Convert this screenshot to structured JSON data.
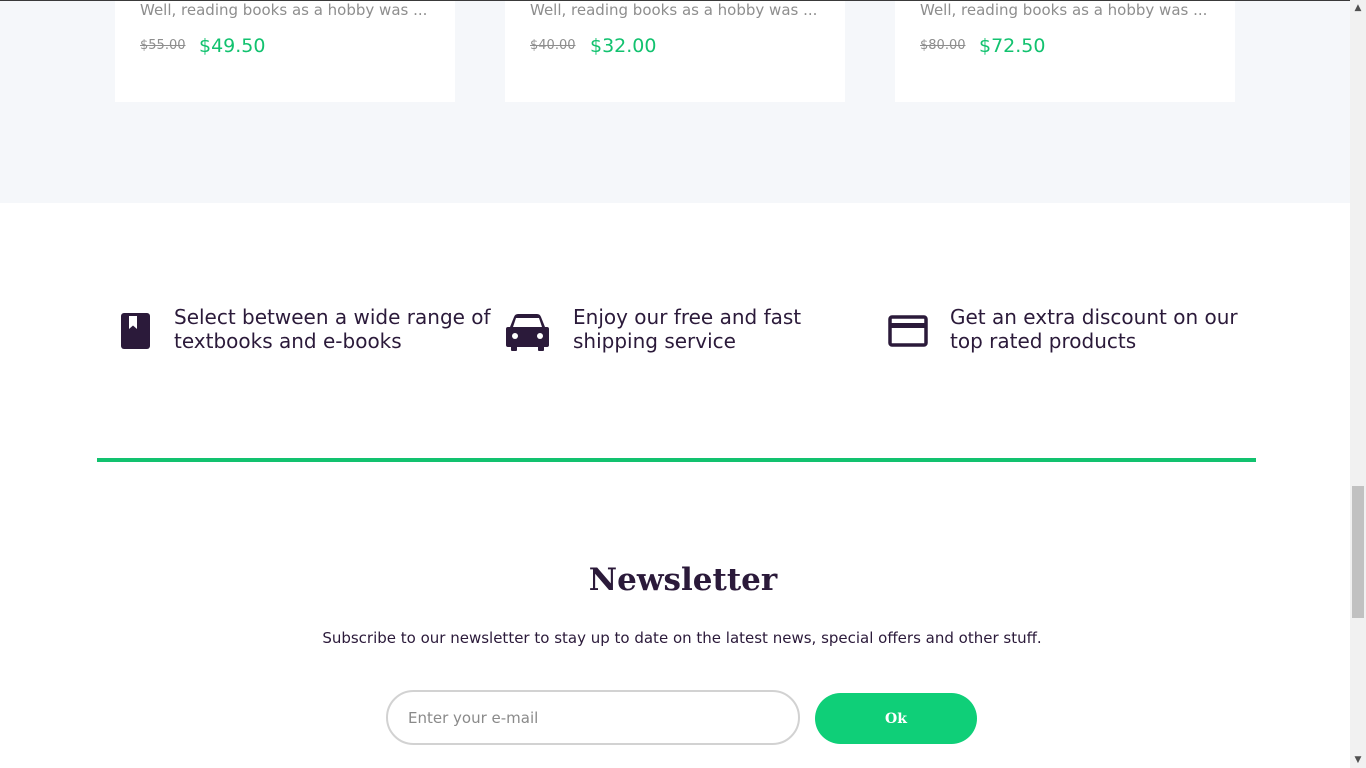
{
  "products": [
    {
      "description": "Well, reading books as a hobby was ...",
      "old_price": "$55.00",
      "new_price": "$49.50"
    },
    {
      "description": "Well, reading books as a hobby was ...",
      "old_price": "$40.00",
      "new_price": "$32.00"
    },
    {
      "description": "Well, reading books as a hobby was ...",
      "old_price": "$80.00",
      "new_price": "$72.50"
    }
  ],
  "features": [
    {
      "icon": "book-icon",
      "text_line1": "Select between a wide range of",
      "text_line2": "textbooks and e-books"
    },
    {
      "icon": "car-icon",
      "text_line1": "Enjoy our free and fast",
      "text_line2": "shipping service"
    },
    {
      "icon": "credit-card-icon",
      "text_line1": "Get an extra discount on our",
      "text_line2": "top rated products"
    }
  ],
  "newsletter": {
    "title": "Newsletter",
    "subtitle": "Subscribe to our newsletter to stay up to date on the latest news, special offers and other stuff.",
    "email_placeholder": "Enter your e-mail",
    "email_value": "",
    "button_label": "Ok"
  },
  "colors": {
    "accent": "#12c26f",
    "button": "#0fcf78",
    "text_dark": "#2b1a3a",
    "muted": "#8e8e8e",
    "band_bg": "#f5f7fa"
  },
  "scrollbar": {
    "icon_up": "scroll-up-arrow-icon",
    "icon_down": "scroll-down-arrow-icon"
  }
}
